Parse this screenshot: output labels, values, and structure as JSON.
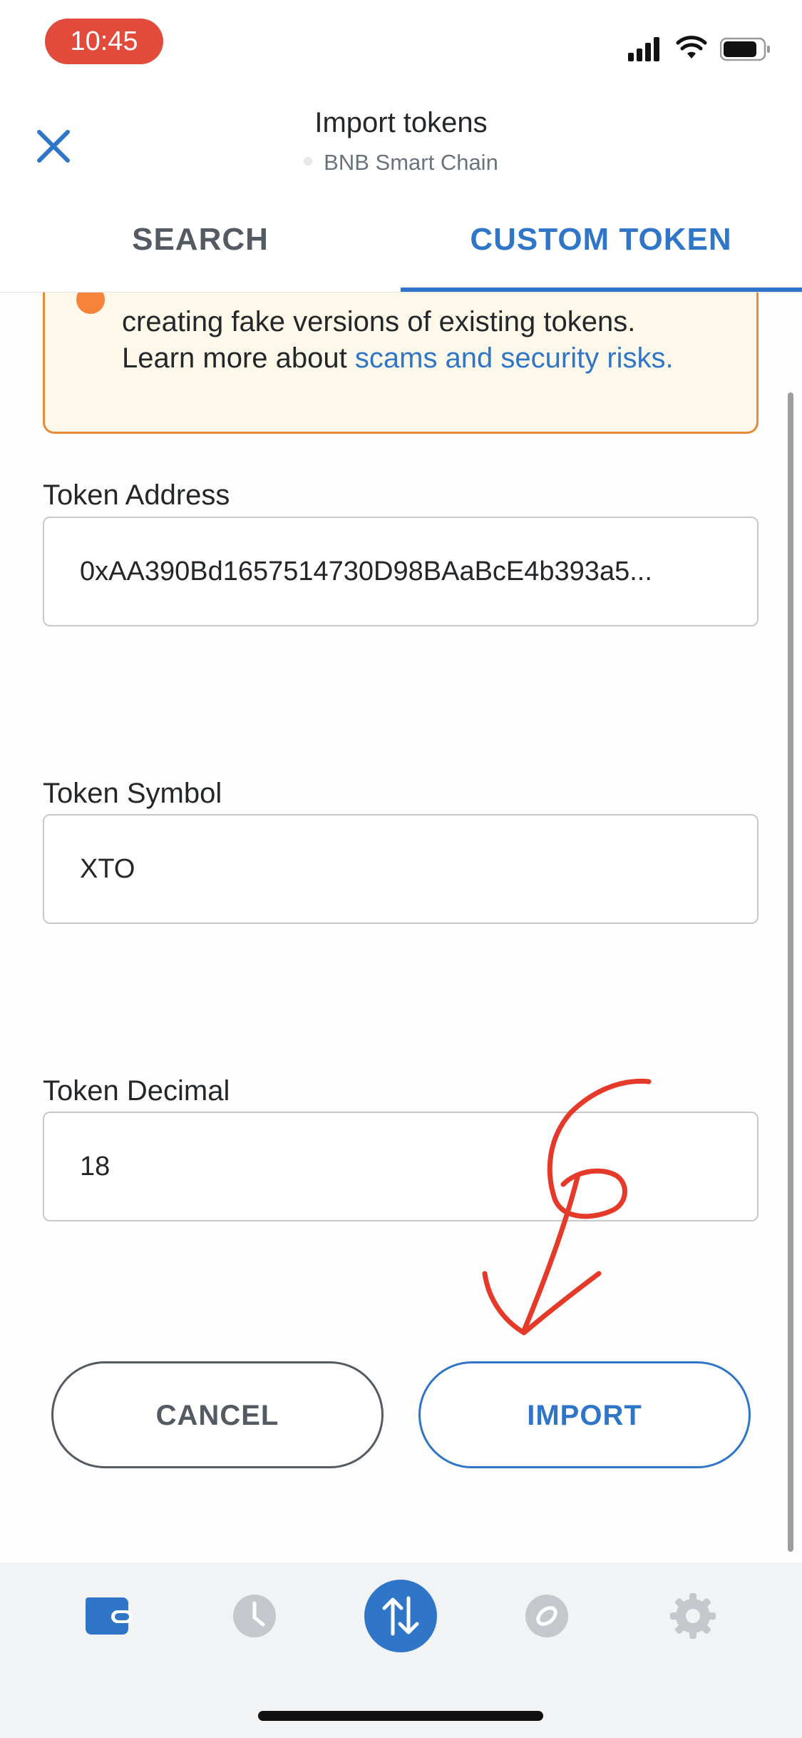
{
  "status_bar": {
    "time": "10:45",
    "accent_color": "#e24a3b"
  },
  "header": {
    "close_icon": "close-icon",
    "title": "Import tokens",
    "network": "BNB Smart Chain"
  },
  "tabs": [
    {
      "label": "SEARCH",
      "active": false
    },
    {
      "label": "CUSTOM TOKEN",
      "active": true
    }
  ],
  "warning": {
    "text_line_1": "creating fake versions of existing tokens.",
    "text_line_2": "Learn more about ",
    "link_text": "scams and security risks."
  },
  "form": {
    "token_address": {
      "label": "Token Address",
      "value": "0xAA390Bd1657514730D98BAaBcE4b393a5..."
    },
    "token_symbol": {
      "label": "Token Symbol",
      "value": "XTO"
    },
    "token_decimal": {
      "label": "Token Decimal",
      "value": "18"
    }
  },
  "buttons": {
    "cancel_label": "CANCEL",
    "import_label": "IMPORT"
  },
  "bottom_nav": [
    {
      "name": "wallet",
      "icon": "wallet-icon",
      "active": true
    },
    {
      "name": "activity",
      "icon": "clock-icon",
      "active": false
    },
    {
      "name": "swap",
      "icon": "swap-arrows-icon",
      "active": false
    },
    {
      "name": "browser",
      "icon": "compass-icon",
      "active": false
    },
    {
      "name": "settings",
      "icon": "gear-icon",
      "active": false
    }
  ],
  "colors": {
    "primary": "#2f76c9",
    "warning_border": "#e58b37",
    "warning_bg": "#fef8ea",
    "annotation": "#e53a2a"
  }
}
